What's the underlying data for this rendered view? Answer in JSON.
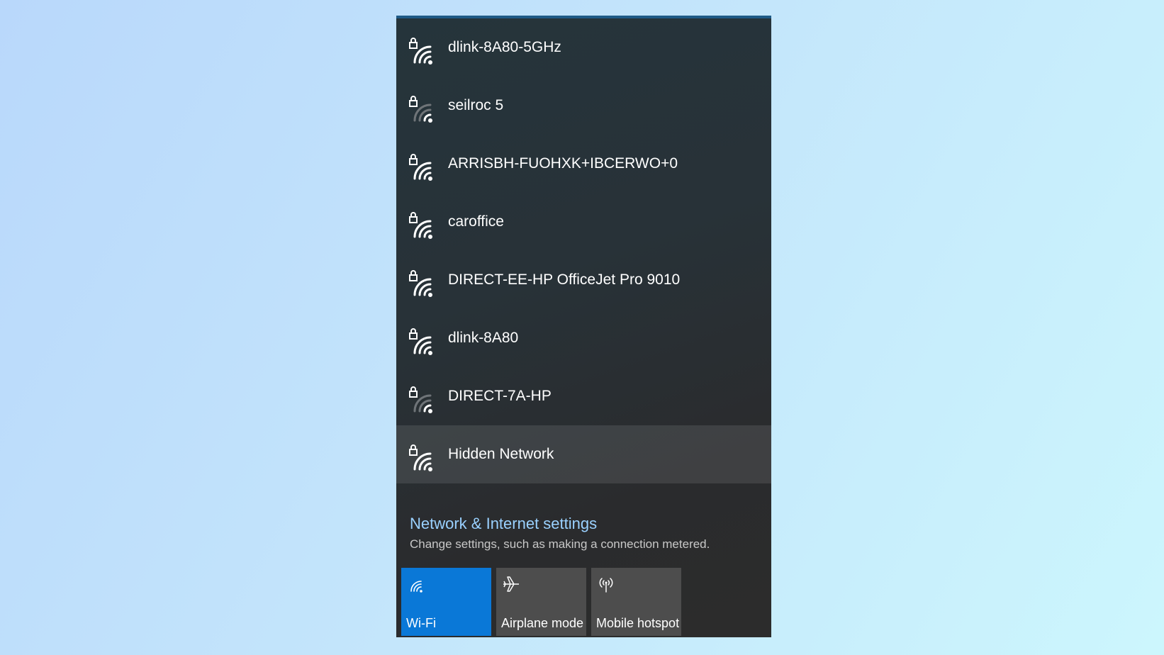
{
  "networks": [
    {
      "name": "dlink-8A80-5GHz",
      "secured": true,
      "signal": 4
    },
    {
      "name": "seilroc 5",
      "secured": true,
      "signal": 2
    },
    {
      "name": "ARRISBH-FUOHXK+IBCERWO+0",
      "secured": true,
      "signal": 4
    },
    {
      "name": "caroffice",
      "secured": true,
      "signal": 4
    },
    {
      "name": "DIRECT-EE-HP OfficeJet Pro 9010",
      "secured": true,
      "signal": 4
    },
    {
      "name": "dlink-8A80",
      "secured": true,
      "signal": 4
    },
    {
      "name": "DIRECT-7A-HP",
      "secured": true,
      "signal": 2
    },
    {
      "name": "Hidden Network",
      "secured": true,
      "signal": 4
    }
  ],
  "settings": {
    "link": "Network & Internet settings",
    "description": "Change settings, such as making a connection metered."
  },
  "quick_actions": [
    {
      "label": "Wi-Fi",
      "icon": "wifi-icon",
      "active": true
    },
    {
      "label": "Airplane mode",
      "icon": "airplane-icon",
      "active": false
    },
    {
      "label": "Mobile hotspot",
      "icon": "hotspot-icon",
      "active": false
    }
  ],
  "colors": {
    "accent": "#0a78d7",
    "link": "#9ad1ff",
    "flyout_bg": "#2a2f33",
    "tile_bg": "#4d4d4d"
  }
}
